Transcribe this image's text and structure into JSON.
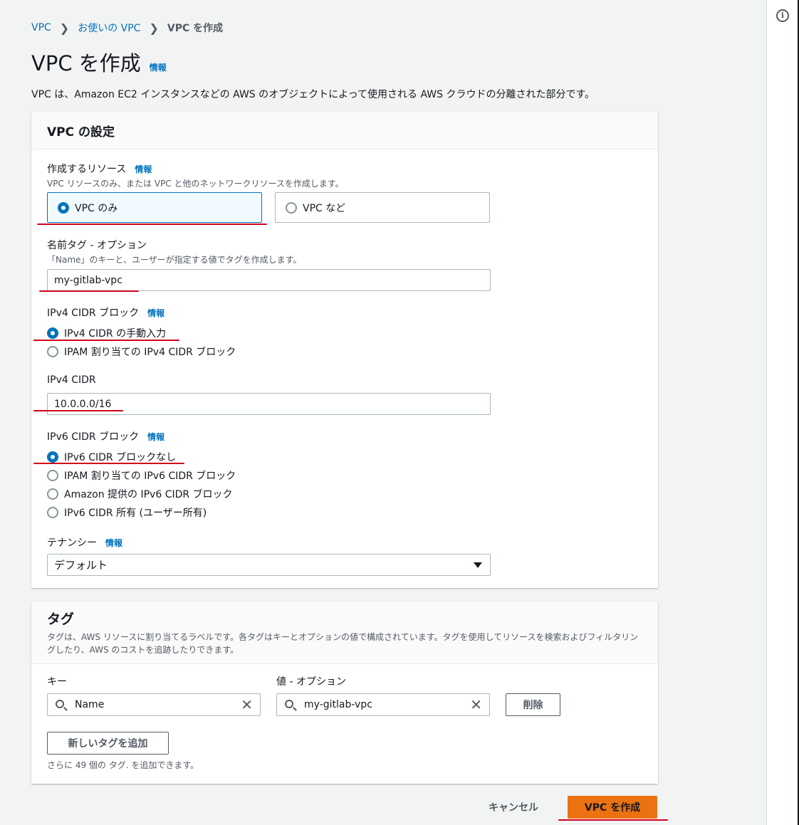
{
  "breadcrumb": {
    "item1": "VPC",
    "item2": "お使いの VPC",
    "current": "VPC を作成"
  },
  "page": {
    "title": "VPC を作成",
    "info": "情報",
    "description": "VPC は、Amazon EC2 インスタンスなどの AWS のオブジェクトによって使用される AWS クラウドの分離された部分です。"
  },
  "vpc_settings": {
    "heading": "VPC の設定",
    "resources": {
      "label": "作成するリソース",
      "info": "情報",
      "description": "VPC リソースのみ、または VPC と他のネットワークリソースを作成します。",
      "options": [
        "VPC のみ",
        "VPC など"
      ],
      "selected": "VPC のみ"
    },
    "name_tag": {
      "label": "名前タグ - オプション",
      "description": "「Name」のキーと、ユーザーが指定する値でタグを作成します。",
      "value": "my-gitlab-vpc"
    },
    "ipv4_block": {
      "label": "IPv4 CIDR ブロック",
      "info": "情報",
      "options": [
        "IPv4 CIDR の手動入力",
        "IPAM 割り当ての IPv4 CIDR ブロック"
      ],
      "selected": "IPv4 CIDR の手動入力"
    },
    "ipv4_cidr": {
      "label": "IPv4 CIDR",
      "value": "10.0.0.0/16"
    },
    "ipv6_block": {
      "label": "IPv6 CIDR ブロック",
      "info": "情報",
      "options": [
        "IPv6 CIDR ブロックなし",
        "IPAM 割り当ての IPv6 CIDR ブロック",
        "Amazon 提供の IPv6 CIDR ブロック",
        "IPv6 CIDR 所有 (ユーザー所有)"
      ],
      "selected": "IPv6 CIDR ブロックなし"
    },
    "tenancy": {
      "label": "テナンシー",
      "info": "情報",
      "value": "デフォルト"
    }
  },
  "tags": {
    "heading": "タグ",
    "description": "タグは、AWS リソースに割り当てるラベルです。各タグはキーとオプションの値で構成されています。タグを使用してリソースを検索およびフィルタリングしたり、AWS のコストを追跡したりできます。",
    "key_label": "キー",
    "value_label": "値 - オプション",
    "key_value": "Name",
    "value_value": "my-gitlab-vpc",
    "remove_label": "削除",
    "add_label": "新しいタグを追加",
    "hint": "さらに 49 個の タグ. を追加できます。"
  },
  "footer": {
    "cancel_label": "キャンセル",
    "create_label": "VPC を作成"
  },
  "colors": {
    "accent": "#0073bb",
    "primary_button": "#ec7211",
    "annotation": "#d0021b"
  },
  "icons": [
    "chevron-right-icon",
    "info-icon",
    "search-icon",
    "close-icon",
    "caret-down-icon"
  ]
}
